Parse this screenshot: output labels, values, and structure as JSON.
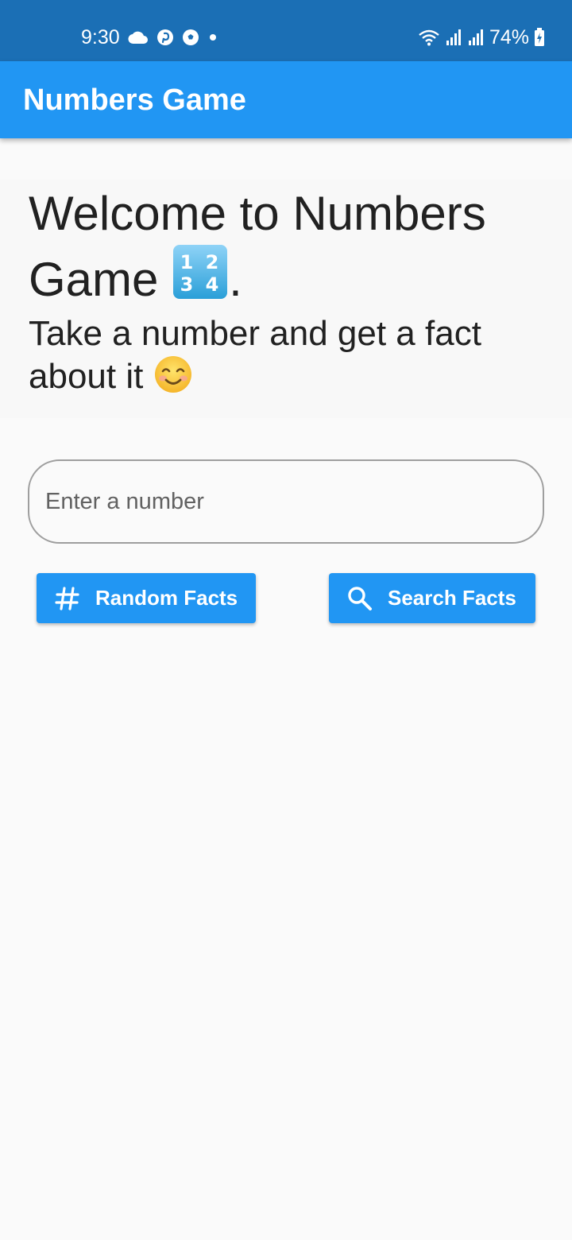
{
  "status_bar": {
    "time": "9:30",
    "battery": "74%",
    "icons": [
      "cloud-icon",
      "pinterest-icon",
      "soccer-ball-icon",
      "dot-icon",
      "wifi-icon",
      "signal-icon",
      "signal-icon",
      "battery-charging-icon"
    ]
  },
  "app_bar": {
    "title": "Numbers Game",
    "color": "#2196f3"
  },
  "welcome": {
    "heading": "Welcome to Numbers Game",
    "heading_suffix": ".",
    "subtitle": "Take a number and get a fact about it"
  },
  "input": {
    "placeholder": "Enter a number",
    "value": ""
  },
  "buttons": {
    "random_label": "Random Facts",
    "random_icon": "hashtag-icon",
    "search_label": "Search Facts",
    "search_icon": "search-icon"
  },
  "colors": {
    "status_bar": "#1b6fb5",
    "accent": "#2196f3",
    "background": "#fafafa"
  }
}
